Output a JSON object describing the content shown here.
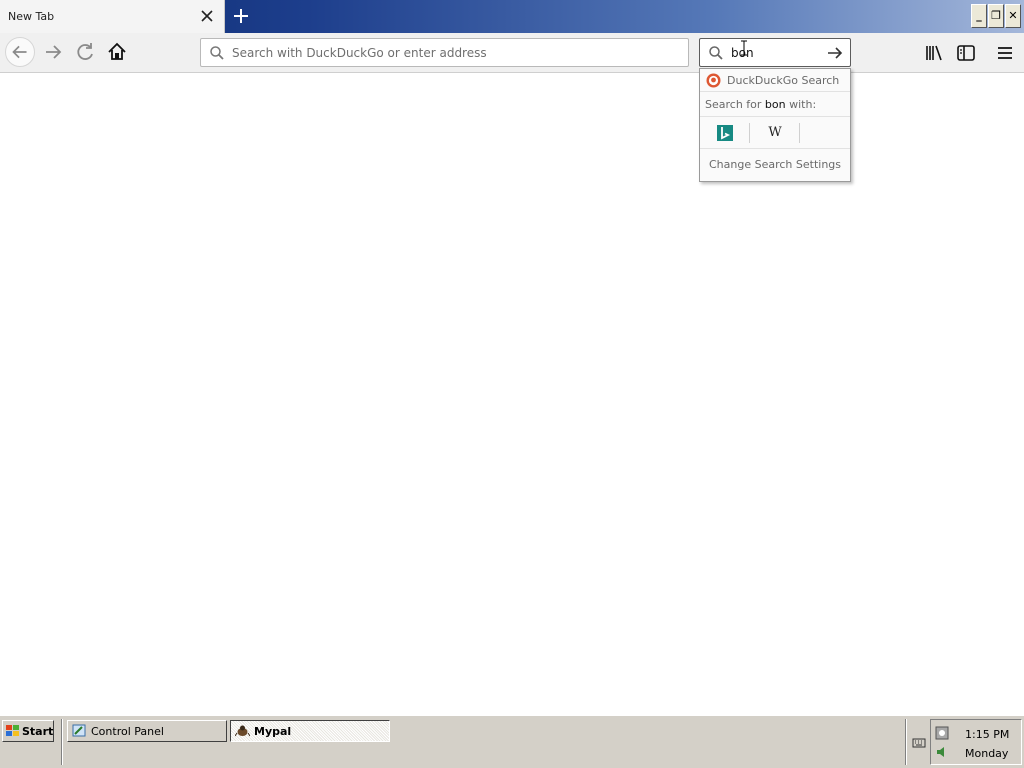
{
  "tabstrip": {
    "tab_title": "New Tab",
    "close_icon": "close-icon",
    "new_tab_icon": "plus-icon",
    "gradient_colors": [
      "#0a2a6e",
      "#a4b7da"
    ]
  },
  "window_controls": {
    "minimize": "_",
    "maximize": "❐",
    "close": "✕"
  },
  "toolbar": {
    "back_icon": "back-arrow-icon",
    "forward_icon": "forward-arrow-icon",
    "reload_icon": "reload-icon",
    "home_icon": "home-icon",
    "library_icon": "library-icon",
    "sidebar_icon": "sidebar-icon",
    "menu_icon": "hamburger-menu-icon"
  },
  "urlbar": {
    "placeholder": "Search with DuckDuckGo or enter address",
    "value": ""
  },
  "searchbar": {
    "value": "bon",
    "go_icon": "arrow-right-icon"
  },
  "search_popup": {
    "engine_label": "DuckDuckGo Search",
    "search_for_prefix": "Search for ",
    "query": "bon",
    "search_for_suffix": " with:",
    "engines": [
      {
        "name": "Bing",
        "glyph": "b",
        "icon": "bing-icon",
        "color": "#178a83"
      },
      {
        "name": "Wikipedia",
        "glyph": "W",
        "icon": "wikipedia-icon"
      }
    ],
    "change_settings": "Change Search Settings",
    "ddg_color": "#de5833"
  },
  "taskbar": {
    "start_label": "Start",
    "tasks": [
      {
        "label": "Control Panel",
        "icon": "control-panel-icon",
        "active": false
      },
      {
        "label": "Mypal",
        "icon": "mypal-icon",
        "active": true
      }
    ],
    "clock_time": "1:15 PM",
    "clock_day": "Monday"
  }
}
